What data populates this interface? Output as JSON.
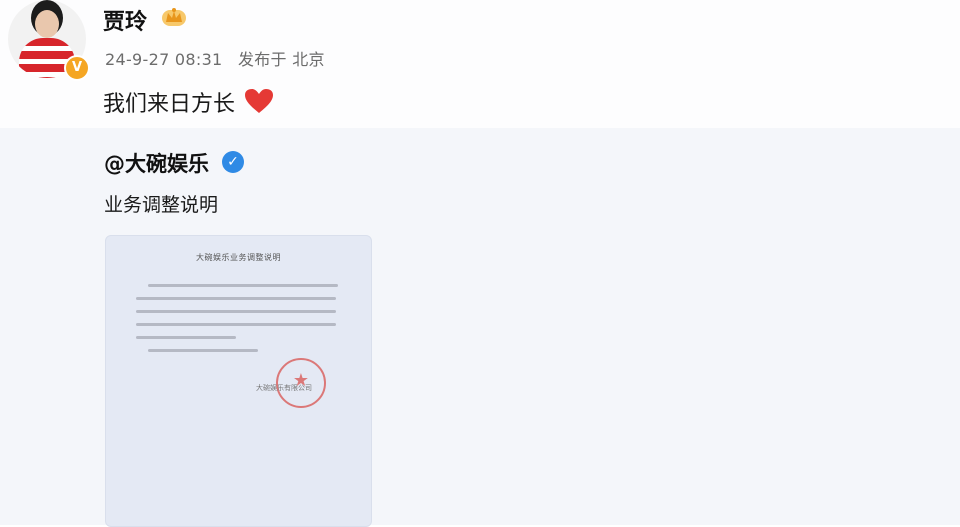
{
  "post": {
    "author": "贾玲",
    "badge_icon": "crown-icon",
    "verified_badge": "V",
    "timestamp": "24-9-27 08:31",
    "source": "发布于 北京",
    "text": "我们来日方长"
  },
  "repost": {
    "author": "@大碗娱乐",
    "verified_icon": "✓",
    "text": "业务调整说明",
    "document": {
      "title": "大碗娱乐业务调整说明",
      "signature": "大碗娱乐有限公司"
    }
  },
  "colors": {
    "heart": "#e53935",
    "verified_blue": "#2f8ae5",
    "vip_orange": "#f5a623",
    "seal_red": "#d9534f"
  }
}
